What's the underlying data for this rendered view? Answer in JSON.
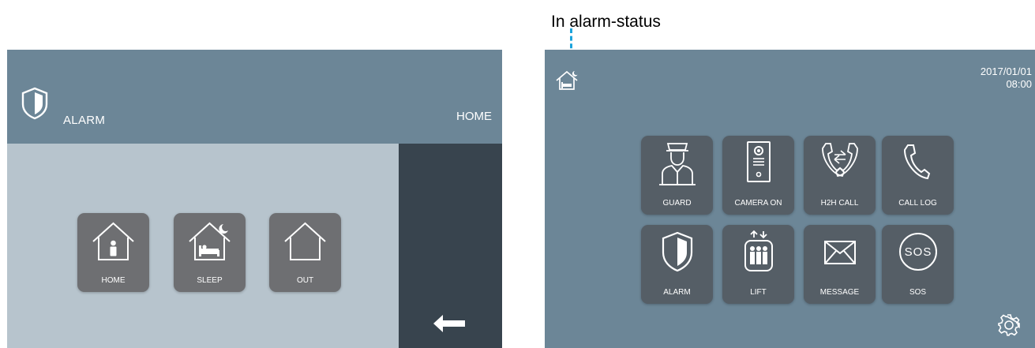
{
  "annotation": {
    "text": "In alarm-status"
  },
  "alarm_screen": {
    "title": "ALARM",
    "current_mode": "HOME",
    "modes": [
      {
        "label": "HOME",
        "icon": "house-person-icon"
      },
      {
        "label": "SLEEP",
        "icon": "house-bed-moon-icon"
      },
      {
        "label": "OUT",
        "icon": "house-empty-icon"
      }
    ],
    "back_icon": "left-arrow-icon"
  },
  "main_screen": {
    "status_icon": "house-bed-moon-icon",
    "date": "2017/01/01",
    "time": "08:00",
    "apps": [
      {
        "label": "GUARD",
        "icon": "guard-icon"
      },
      {
        "label": "CAMERA ON",
        "icon": "camera-door-icon"
      },
      {
        "label": "H2H CALL",
        "icon": "h2h-call-icon"
      },
      {
        "label": "CALL LOG",
        "icon": "phone-handset-icon"
      },
      {
        "label": "ALARM",
        "icon": "shield-icon"
      },
      {
        "label": "LIFT",
        "icon": "lift-icon"
      },
      {
        "label": "MESSAGE",
        "icon": "envelope-icon"
      },
      {
        "label": "SOS",
        "icon": "sos-icon"
      }
    ],
    "settings_icon": "gear-icon"
  },
  "colors": {
    "header": "#6c8697",
    "left_body": "#b7c4cd",
    "sidebar": "#38444e",
    "mode_tile": "#6e6f72",
    "app_tile": "#555e66",
    "annotation_line": "#1ba3dc"
  }
}
